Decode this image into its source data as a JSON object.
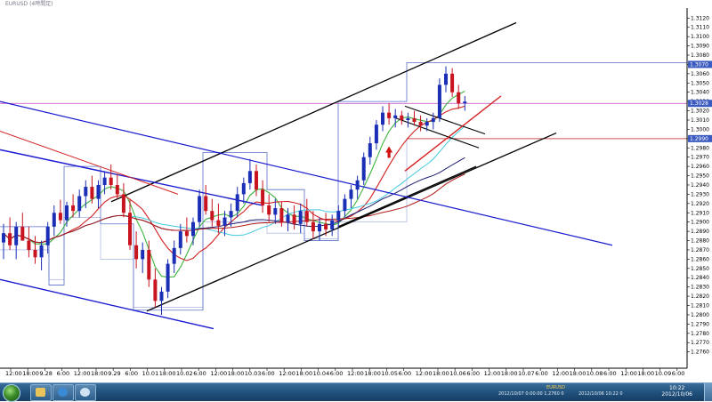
{
  "window": {
    "title": "EURUSD (4時間足)"
  },
  "chart": {
    "symbol": "EURUSD",
    "timeframe": "4時間足",
    "colors": {
      "bull": "#1a2fb5",
      "bear": "#c8141e",
      "ma_fast": "#d42020",
      "ma_green": "#3cb43c",
      "ma_cyan": "#40c8e0",
      "ma_navy": "#1a1a6e",
      "ma_darkred": "#b01818",
      "trendline_black": "#000000",
      "trendline_blue": "#1a1ad0",
      "box": "#5a6ec8",
      "hline_violet": "#c040c0",
      "hline_red": "#c02020",
      "price_tag": "#3a5ac0"
    },
    "price_ticks": [
      "1.3120",
      "1.3110",
      "1.3100",
      "1.3090",
      "1.3080",
      "1.3070",
      "1.3060",
      "1.3050",
      "1.3040",
      "1.3030",
      "1.3020",
      "1.3010",
      "1.3000",
      "1.2990",
      "1.2980",
      "1.2970",
      "1.2960",
      "1.2950",
      "1.2940",
      "1.2930",
      "1.2920",
      "1.2910",
      "1.2900",
      "1.2890",
      "1.2880",
      "1.2870",
      "1.2860",
      "1.2850",
      "1.2840",
      "1.2830",
      "1.2820",
      "1.2810",
      "1.2800",
      "1.2790",
      "1.2780",
      "1.2770",
      "1.2760"
    ],
    "price_range": [
      1.2752,
      1.3127
    ],
    "price_tags": [
      {
        "value": "1.3070",
        "price": 1.307
      },
      {
        "value": "1.3028",
        "price": 1.3028
      },
      {
        "value": "1.2990",
        "price": 1.299
      }
    ],
    "time_ticks": [
      "12:00",
      "18:00",
      "9.28",
      "6:00",
      "12:00",
      "18:00",
      "9.29",
      "6:00",
      "10.01",
      "18:00",
      "10.02",
      "6:00",
      "12:00",
      "18:00",
      "10.03",
      "6:00",
      "12:00",
      "18:00",
      "10.04",
      "6:00",
      "12:00",
      "18:00",
      "10.05",
      "6:00",
      "12:00",
      "18:00",
      "10.06",
      "6:00",
      "12:00",
      "18:00",
      "10.07",
      "6:00",
      "12:00",
      "18:00",
      "10.08",
      "6:00",
      "12:00",
      "18:00",
      "10.09",
      "6:00"
    ],
    "candles": [
      {
        "o": 1.2878,
        "h": 1.2898,
        "l": 1.286,
        "c": 1.2888
      },
      {
        "o": 1.2888,
        "h": 1.2905,
        "l": 1.287,
        "c": 1.2875
      },
      {
        "o": 1.2875,
        "h": 1.29,
        "l": 1.286,
        "c": 1.2895
      },
      {
        "o": 1.2895,
        "h": 1.291,
        "l": 1.288,
        "c": 1.288
      },
      {
        "o": 1.288,
        "h": 1.2895,
        "l": 1.2862,
        "c": 1.287
      },
      {
        "o": 1.287,
        "h": 1.2885,
        "l": 1.2855,
        "c": 1.2862
      },
      {
        "o": 1.2862,
        "h": 1.288,
        "l": 1.2848,
        "c": 1.2875
      },
      {
        "o": 1.2875,
        "h": 1.29,
        "l": 1.2866,
        "c": 1.2895
      },
      {
        "o": 1.2895,
        "h": 1.2918,
        "l": 1.2885,
        "c": 1.291
      },
      {
        "o": 1.291,
        "h": 1.2924,
        "l": 1.2898,
        "c": 1.2902
      },
      {
        "o": 1.2902,
        "h": 1.2922,
        "l": 1.2895,
        "c": 1.2918
      },
      {
        "o": 1.2918,
        "h": 1.293,
        "l": 1.2905,
        "c": 1.2912
      },
      {
        "o": 1.2912,
        "h": 1.2935,
        "l": 1.2905,
        "c": 1.2928
      },
      {
        "o": 1.2928,
        "h": 1.2945,
        "l": 1.2915,
        "c": 1.2938
      },
      {
        "o": 1.2938,
        "h": 1.295,
        "l": 1.292,
        "c": 1.2925
      },
      {
        "o": 1.2925,
        "h": 1.2945,
        "l": 1.2915,
        "c": 1.294
      },
      {
        "o": 1.294,
        "h": 1.2955,
        "l": 1.293,
        "c": 1.2948
      },
      {
        "o": 1.2948,
        "h": 1.2962,
        "l": 1.2935,
        "c": 1.294
      },
      {
        "o": 1.294,
        "h": 1.2952,
        "l": 1.2925,
        "c": 1.293
      },
      {
        "o": 1.293,
        "h": 1.2942,
        "l": 1.2905,
        "c": 1.291
      },
      {
        "o": 1.291,
        "h": 1.2925,
        "l": 1.287,
        "c": 1.2875
      },
      {
        "o": 1.2875,
        "h": 1.289,
        "l": 1.285,
        "c": 1.286
      },
      {
        "o": 1.286,
        "h": 1.2878,
        "l": 1.2845,
        "c": 1.287
      },
      {
        "o": 1.287,
        "h": 1.288,
        "l": 1.283,
        "c": 1.2838
      },
      {
        "o": 1.2838,
        "h": 1.285,
        "l": 1.2808,
        "c": 1.2815
      },
      {
        "o": 1.2815,
        "h": 1.283,
        "l": 1.28,
        "c": 1.2825
      },
      {
        "o": 1.2825,
        "h": 1.286,
        "l": 1.2818,
        "c": 1.2855
      },
      {
        "o": 1.2855,
        "h": 1.288,
        "l": 1.2845,
        "c": 1.2872
      },
      {
        "o": 1.2872,
        "h": 1.2898,
        "l": 1.2865,
        "c": 1.289
      },
      {
        "o": 1.289,
        "h": 1.2905,
        "l": 1.2878,
        "c": 1.2885
      },
      {
        "o": 1.2885,
        "h": 1.2905,
        "l": 1.2875,
        "c": 1.29
      },
      {
        "o": 1.29,
        "h": 1.2935,
        "l": 1.2895,
        "c": 1.2928
      },
      {
        "o": 1.2928,
        "h": 1.294,
        "l": 1.2908,
        "c": 1.2912
      },
      {
        "o": 1.2912,
        "h": 1.2925,
        "l": 1.2895,
        "c": 1.2902
      },
      {
        "o": 1.2902,
        "h": 1.292,
        "l": 1.2888,
        "c": 1.2896
      },
      {
        "o": 1.2896,
        "h": 1.2912,
        "l": 1.2885,
        "c": 1.2905
      },
      {
        "o": 1.2905,
        "h": 1.292,
        "l": 1.2895,
        "c": 1.2912
      },
      {
        "o": 1.2912,
        "h": 1.2938,
        "l": 1.2905,
        "c": 1.293
      },
      {
        "o": 1.293,
        "h": 1.2948,
        "l": 1.292,
        "c": 1.2942
      },
      {
        "o": 1.2942,
        "h": 1.2968,
        "l": 1.2935,
        "c": 1.2955
      },
      {
        "o": 1.2955,
        "h": 1.2962,
        "l": 1.2928,
        "c": 1.2935
      },
      {
        "o": 1.2935,
        "h": 1.2945,
        "l": 1.291,
        "c": 1.2918
      },
      {
        "o": 1.2918,
        "h": 1.293,
        "l": 1.29,
        "c": 1.2908
      },
      {
        "o": 1.2908,
        "h": 1.2925,
        "l": 1.2898,
        "c": 1.2915
      },
      {
        "o": 1.2915,
        "h": 1.2922,
        "l": 1.2895,
        "c": 1.29
      },
      {
        "o": 1.29,
        "h": 1.2915,
        "l": 1.289,
        "c": 1.2908
      },
      {
        "o": 1.2908,
        "h": 1.2918,
        "l": 1.2892,
        "c": 1.2898
      },
      {
        "o": 1.2898,
        "h": 1.292,
        "l": 1.2888,
        "c": 1.2912
      },
      {
        "o": 1.2912,
        "h": 1.2925,
        "l": 1.2895,
        "c": 1.29
      },
      {
        "o": 1.29,
        "h": 1.2912,
        "l": 1.2882,
        "c": 1.289
      },
      {
        "o": 1.289,
        "h": 1.2905,
        "l": 1.288,
        "c": 1.2898
      },
      {
        "o": 1.2898,
        "h": 1.291,
        "l": 1.2885,
        "c": 1.2892
      },
      {
        "o": 1.2892,
        "h": 1.2908,
        "l": 1.2885,
        "c": 1.2902
      },
      {
        "o": 1.2902,
        "h": 1.2918,
        "l": 1.2895,
        "c": 1.2912
      },
      {
        "o": 1.2912,
        "h": 1.293,
        "l": 1.2905,
        "c": 1.2925
      },
      {
        "o": 1.2925,
        "h": 1.294,
        "l": 1.2915,
        "c": 1.2935
      },
      {
        "o": 1.2935,
        "h": 1.295,
        "l": 1.2925,
        "c": 1.2945
      },
      {
        "o": 1.2945,
        "h": 1.2975,
        "l": 1.294,
        "c": 1.297
      },
      {
        "o": 1.297,
        "h": 1.2992,
        "l": 1.2962,
        "c": 1.2985
      },
      {
        "o": 1.2985,
        "h": 1.301,
        "l": 1.2978,
        "c": 1.3005
      },
      {
        "o": 1.3005,
        "h": 1.3025,
        "l": 1.2998,
        "c": 1.3018
      },
      {
        "o": 1.3018,
        "h": 1.3028,
        "l": 1.3005,
        "c": 1.3012
      },
      {
        "o": 1.3012,
        "h": 1.3022,
        "l": 1.3002,
        "c": 1.3015
      },
      {
        "o": 1.3015,
        "h": 1.302,
        "l": 1.3005,
        "c": 1.301
      },
      {
        "o": 1.301,
        "h": 1.3018,
        "l": 1.3002,
        "c": 1.3012
      },
      {
        "o": 1.3012,
        "h": 1.302,
        "l": 1.3004,
        "c": 1.3008
      },
      {
        "o": 1.3008,
        "h": 1.3015,
        "l": 1.2998,
        "c": 1.3004
      },
      {
        "o": 1.3004,
        "h": 1.3012,
        "l": 1.2998,
        "c": 1.3008
      },
      {
        "o": 1.3008,
        "h": 1.3018,
        "l": 1.3,
        "c": 1.3012
      },
      {
        "o": 1.3012,
        "h": 1.3055,
        "l": 1.3008,
        "c": 1.3048
      },
      {
        "o": 1.3048,
        "h": 1.3068,
        "l": 1.304,
        "c": 1.306
      },
      {
        "o": 1.306,
        "h": 1.3066,
        "l": 1.3035,
        "c": 1.304
      },
      {
        "o": 1.304,
        "h": 1.3048,
        "l": 1.3022,
        "c": 1.3028
      },
      {
        "o": 1.3028,
        "h": 1.3036,
        "l": 1.302,
        "c": 1.303
      }
    ]
  },
  "taskbar": {
    "tray_symbol": "EURUSD",
    "tray_ticker": "2012/10/07 0:00:00 1.2760 0",
    "tray_ticker2": "2012/10/06 10:22 0",
    "clock_time": "10:22",
    "clock_date": "2012/10/06"
  }
}
